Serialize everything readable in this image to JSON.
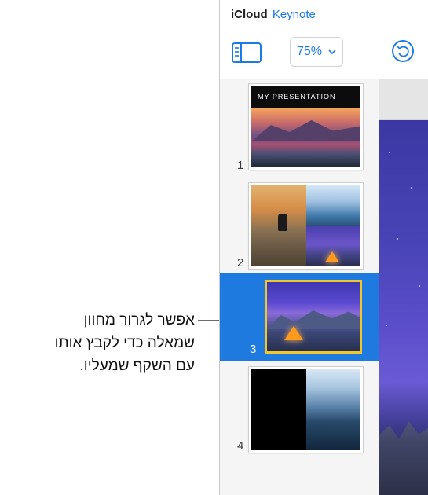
{
  "header": {
    "brand_icloud": "iCloud",
    "brand_app": "Keynote"
  },
  "toolbar": {
    "sidebar_toggle_icon": "sidebar-icon",
    "zoom_value": "75%",
    "zoom_chevron_icon": "chevron-down-icon",
    "undo_icon": "undo-icon"
  },
  "navigator": {
    "slides": [
      {
        "number": "1",
        "title": "MY PRESENTATION"
      },
      {
        "number": "2"
      },
      {
        "number": "3",
        "selected": true
      },
      {
        "number": "4"
      }
    ]
  },
  "callout": {
    "lines": [
      "אפשר לגרור מחוון",
      "שמאלה כדי לקבץ אותו",
      "עם השקף שמעליו."
    ]
  },
  "colors": {
    "accent": "#1a7ae6",
    "selection": "#1f7ae0",
    "selected_thumb_border": "#f2c72c"
  }
}
